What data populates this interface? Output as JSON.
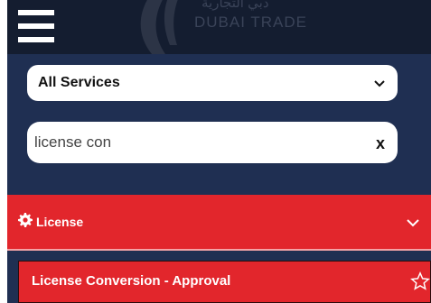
{
  "header": {
    "logo_text": "DUBAI TRADE",
    "logo_arabic": "دبي التجارية"
  },
  "filters": {
    "service_select_value": "All Services",
    "search_value": "license con",
    "clear_label": "x"
  },
  "category": {
    "label": "License"
  },
  "results": [
    {
      "label": "License Conversion - Approval"
    }
  ],
  "colors": {
    "panel_bg": "#1f2f52",
    "header_bg": "#141d30",
    "accent_red": "#e2262c"
  }
}
